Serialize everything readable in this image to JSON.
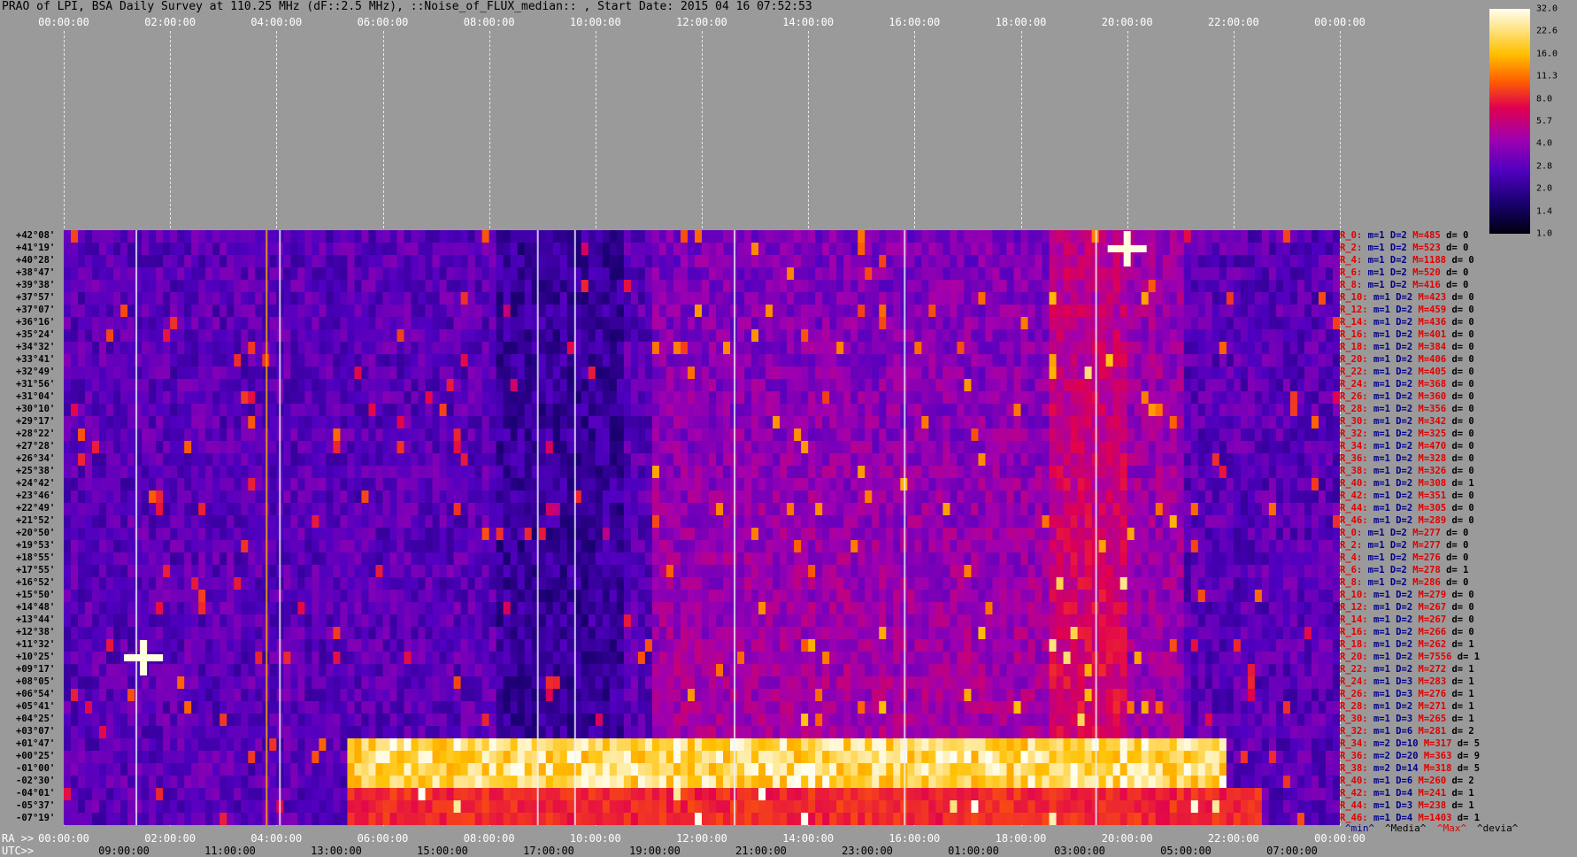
{
  "title": "PRAO of LPI, BSA Daily Survey at 110.25 MHz (dF::2.5 MHz), ::Noise_of_FLUX_median:: , Start Date: 2015 04 16 07:52:53",
  "top_axis_labels": [
    "00:00:00",
    "02:00:00",
    "04:00:00",
    "06:00:00",
    "08:00:00",
    "10:00:00",
    "12:00:00",
    "14:00:00",
    "16:00:00",
    "18:00:00",
    "20:00:00",
    "22:00:00",
    "00:00:00"
  ],
  "colorbar": {
    "ticks": [
      "32.0",
      "22.6",
      "16.0",
      "11.3",
      "8.0",
      "5.7",
      "4.0",
      "2.8",
      "2.0",
      "1.4",
      "1.0"
    ],
    "colors": [
      "#000010",
      "#1a0070",
      "#5000c0",
      "#a000b0",
      "#e00050",
      "#ff6000",
      "#ffc000",
      "#fffff0"
    ]
  },
  "declinations": [
    "+42°08'",
    "+41°19'",
    "+40°28'",
    "+38°47'",
    "+39°38'",
    "+37°57'",
    "+37°07'",
    "+36°16'",
    "+35°24'",
    "+34°32'",
    "+33°41'",
    "+32°49'",
    "+31°56'",
    "+31°04'",
    "+30°10'",
    "+29°17'",
    "+28°22'",
    "+27°28'",
    "+26°34'",
    "+25°38'",
    "+24°42'",
    "+23°46'",
    "+22°49'",
    "+21°52'",
    "+20°50'",
    "+19°53'",
    "+18°55'",
    "+17°55'",
    "+16°52'",
    "+15°50'",
    "+14°48'",
    "+13°44'",
    "+12°38'",
    "+11°32'",
    "+10°25'",
    "+09°17'",
    "+08°05'",
    "+06°54'",
    "+05°41'",
    "+04°25'",
    "+03°07'",
    "+01°47'",
    "+00°25'",
    "-01°00'",
    "-02°30'",
    "-04°01'",
    "-05°37'",
    "-07°19'"
  ],
  "row_stats": [
    {
      "r": "R_0:",
      "m": "m=1",
      "d2": "D=2",
      "M": "M=485",
      "d": "d= 0"
    },
    {
      "r": "R_2:",
      "m": "m=1",
      "d2": "D=2",
      "M": "M=523",
      "d": "d= 0"
    },
    {
      "r": "R_4:",
      "m": "m=1",
      "d2": "D=2",
      "M": "M=1188",
      "d": "d= 0"
    },
    {
      "r": "R_6:",
      "m": "m=1",
      "d2": "D=2",
      "M": "M=520",
      "d": "d= 0"
    },
    {
      "r": "R_8:",
      "m": "m=1",
      "d2": "D=2",
      "M": "M=416",
      "d": "d= 0"
    },
    {
      "r": "R_10:",
      "m": "m=1",
      "d2": "D=2",
      "M": "M=423",
      "d": "d= 0"
    },
    {
      "r": "R_12:",
      "m": "m=1",
      "d2": "D=2",
      "M": "M=459",
      "d": "d= 0"
    },
    {
      "r": "R_14:",
      "m": "m=1",
      "d2": "D=2",
      "M": "M=436",
      "d": "d= 0"
    },
    {
      "r": "R_16:",
      "m": "m=1",
      "d2": "D=2",
      "M": "M=401",
      "d": "d= 0"
    },
    {
      "r": "R_18:",
      "m": "m=1",
      "d2": "D=2",
      "M": "M=384",
      "d": "d= 0"
    },
    {
      "r": "R_20:",
      "m": "m=1",
      "d2": "D=2",
      "M": "M=406",
      "d": "d= 0"
    },
    {
      "r": "R_22:",
      "m": "m=1",
      "d2": "D=2",
      "M": "M=405",
      "d": "d= 0"
    },
    {
      "r": "R_24:",
      "m": "m=1",
      "d2": "D=2",
      "M": "M=368",
      "d": "d= 0"
    },
    {
      "r": "R_26:",
      "m": "m=1",
      "d2": "D=2",
      "M": "M=360",
      "d": "d= 0"
    },
    {
      "r": "R_28:",
      "m": "m=1",
      "d2": "D=2",
      "M": "M=356",
      "d": "d= 0"
    },
    {
      "r": "R_30:",
      "m": "m=1",
      "d2": "D=2",
      "M": "M=342",
      "d": "d= 0"
    },
    {
      "r": "R_32:",
      "m": "m=1",
      "d2": "D=2",
      "M": "M=325",
      "d": "d= 0"
    },
    {
      "r": "R_34:",
      "m": "m=1",
      "d2": "D=2",
      "M": "M=470",
      "d": "d= 0"
    },
    {
      "r": "R_36:",
      "m": "m=1",
      "d2": "D=2",
      "M": "M=328",
      "d": "d= 0"
    },
    {
      "r": "R_38:",
      "m": "m=1",
      "d2": "D=2",
      "M": "M=326",
      "d": "d= 0"
    },
    {
      "r": "R_40:",
      "m": "m=1",
      "d2": "D=2",
      "M": "M=308",
      "d": "d= 1"
    },
    {
      "r": "R_42:",
      "m": "m=1",
      "d2": "D=2",
      "M": "M=351",
      "d": "d= 0"
    },
    {
      "r": "R_44:",
      "m": "m=1",
      "d2": "D=2",
      "M": "M=305",
      "d": "d= 0"
    },
    {
      "r": "R_46:",
      "m": "m=1",
      "d2": "D=2",
      "M": "M=289",
      "d": "d= 0"
    },
    {
      "r": "R_0:",
      "m": "m=1",
      "d2": "D=2",
      "M": "M=277",
      "d": "d= 0"
    },
    {
      "r": "R_2:",
      "m": "m=1",
      "d2": "D=2",
      "M": "M=277",
      "d": "d= 0"
    },
    {
      "r": "R_4:",
      "m": "m=1",
      "d2": "D=2",
      "M": "M=276",
      "d": "d= 0"
    },
    {
      "r": "R_6:",
      "m": "m=1",
      "d2": "D=2",
      "M": "M=278",
      "d": "d= 1"
    },
    {
      "r": "R_8:",
      "m": "m=1",
      "d2": "D=2",
      "M": "M=286",
      "d": "d= 0"
    },
    {
      "r": "R_10:",
      "m": "m=1",
      "d2": "D=2",
      "M": "M=279",
      "d": "d= 0"
    },
    {
      "r": "R_12:",
      "m": "m=1",
      "d2": "D=2",
      "M": "M=267",
      "d": "d= 0"
    },
    {
      "r": "R_14:",
      "m": "m=1",
      "d2": "D=2",
      "M": "M=267",
      "d": "d= 0"
    },
    {
      "r": "R_16:",
      "m": "m=1",
      "d2": "D=2",
      "M": "M=266",
      "d": "d= 0"
    },
    {
      "r": "R_18:",
      "m": "m=1",
      "d2": "D=2",
      "M": "M=262",
      "d": "d= 1"
    },
    {
      "r": "R_20:",
      "m": "m=1",
      "d2": "D=2",
      "M": "M=7556",
      "d": "d= 1"
    },
    {
      "r": "R_22:",
      "m": "m=1",
      "d2": "D=2",
      "M": "M=272",
      "d": "d= 1"
    },
    {
      "r": "R_24:",
      "m": "m=1",
      "d2": "D=3",
      "M": "M=283",
      "d": "d= 1"
    },
    {
      "r": "R_26:",
      "m": "m=1",
      "d2": "D=3",
      "M": "M=276",
      "d": "d= 1"
    },
    {
      "r": "R_28:",
      "m": "m=1",
      "d2": "D=2",
      "M": "M=271",
      "d": "d= 1"
    },
    {
      "r": "R_30:",
      "m": "m=1",
      "d2": "D=3",
      "M": "M=265",
      "d": "d= 1"
    },
    {
      "r": "R_32:",
      "m": "m=1",
      "d2": "D=6",
      "M": "M=281",
      "d": "d= 2"
    },
    {
      "r": "R_34:",
      "m": "m=2",
      "d2": "D=10",
      "M": "M=317",
      "d": "d= 5"
    },
    {
      "r": "R_36:",
      "m": "m=2",
      "d2": "D=20",
      "M": "M=363",
      "d": "d= 9"
    },
    {
      "r": "R_38:",
      "m": "m=2",
      "d2": "D=14",
      "M": "M=318",
      "d": "d= 5"
    },
    {
      "r": "R_40:",
      "m": "m=1",
      "d2": "D=6",
      "M": "M=260",
      "d": "d= 2"
    },
    {
      "r": "R_42:",
      "m": "m=1",
      "d2": "D=4",
      "M": "M=241",
      "d": "d= 1"
    },
    {
      "r": "R_44:",
      "m": "m=1",
      "d2": "D=3",
      "M": "M=238",
      "d": "d= 1"
    },
    {
      "r": "R_46:",
      "m": "m=1",
      "d2": "D=4",
      "M": "M=1403",
      "d": "d= 1"
    }
  ],
  "bottom": {
    "ra_prefix": "RA >>",
    "ra_labels": [
      "00:00:00",
      "02:00:00",
      "04:00:00",
      "06:00:00",
      "08:00:00",
      "10:00:00",
      "12:00:00",
      "14:00:00",
      "16:00:00",
      "18:00:00",
      "20:00:00",
      "22:00:00",
      "00:00:00"
    ],
    "utc_prefix": "UTC>>",
    "utc_labels": [
      "09:00:00",
      "11:00:00",
      "13:00:00",
      "15:00:00",
      "17:00:00",
      "19:00:00",
      "21:00:00",
      "23:00:00",
      "01:00:00",
      "03:00:00",
      "05:00:00",
      "07:00:00"
    ]
  },
  "legend": [
    "^min^",
    "^Media^",
    "^Max^",
    "^devia^"
  ],
  "chart_data": {
    "type": "heatmap",
    "title": "PRAO of LPI, BSA Daily Survey at 110.25 MHz (dF::2.5 MHz), ::Noise_of_FLUX_median:: , Start Date: 2015 04 16 07:52:53",
    "x_axis_top": "RA 00:00:00 – 00:00:00",
    "y_axis": "Declination +42°08' to -07°19' (48 beams)",
    "colorbar_range": [
      1.0,
      32.0
    ],
    "colorbar_scale": "log",
    "rows": 48,
    "features": [
      {
        "name": "bright horizontal band",
        "rows": [
          41,
          44
        ],
        "ra_start_h": 5.0,
        "ra_end_h": 21.8,
        "level": "max"
      },
      {
        "name": "point source",
        "row": 1,
        "ra_h": 20.0,
        "level": "max"
      },
      {
        "name": "point source",
        "row": 34,
        "ra_h": 1.5,
        "level": "max"
      },
      {
        "name": "vertical interference",
        "ra_h": 3.8,
        "level": "high"
      }
    ]
  }
}
